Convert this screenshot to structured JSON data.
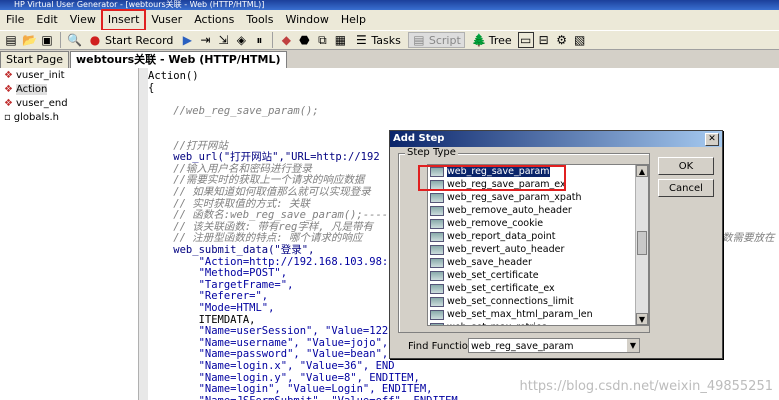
{
  "window": {
    "title": "HP Virtual User Generator - [webtours关联 - Web (HTTP/HTML)]"
  },
  "menu": [
    "File",
    "Edit",
    "View",
    "Insert",
    "Vuser",
    "Actions",
    "Tools",
    "Window",
    "Help"
  ],
  "toolbar": {
    "start_record": "Start Record",
    "tasks": "Tasks",
    "script": "Script",
    "tree": "Tree"
  },
  "tabs": [
    "Start Page",
    "webtours关联 - Web (HTTP/HTML)"
  ],
  "tree": [
    "vuser_init",
    "Action",
    "vuser_end",
    "globals.h"
  ],
  "code": [
    "Action()",
    "{",
    "",
    "    //web_reg_save_param();",
    "",
    "",
    "    //打开网站",
    "    web_url(\"打开网站\",\"URL=http://192",
    "    //输入用户名和密码进行登录",
    "    //需要实时的获取上一个请求的响应数据",
    "    // 如果知道如何取值那么就可以实现登录",
    "    // 实时获取值的方式: 关联",
    "    // 函数名:web_reg_save_param();----",
    "    // 该关联函数: 带有reg字样, 凡是带有",
    "    // 注册型函数的特点: 哪个请求的响应",
    "    web_submit_data(\"登录\",",
    "        \"Action=http://192.168.103.98:",
    "        \"Method=POST\",",
    "        \"TargetFrame=\",",
    "        \"Referer=\",",
    "        \"Mode=HTML\",",
    "        ITEMDATA,",
    "        \"Name=userSession\", \"Value=122",
    "        \"Name=username\", \"Value=jojo\",",
    "        \"Name=password\", \"Value=bean\",",
    "        \"Name=login.x\", \"Value=36\", END",
    "        \"Name=login.y\", \"Value=8\", ENDITEM,",
    "        \"Name=login\", \"Value=Login\", ENDITEM,",
    "        \"Name=JSFormSubmit\", \"Value=off\", ENDITEM,"
  ],
  "code_tail": "数需要放在",
  "dialog": {
    "title": "Add Step",
    "group_label": "Step Type",
    "items": [
      "web_reg_save_param",
      "web_reg_save_param_ex",
      "web_reg_save_param_xpath",
      "web_remove_auto_header",
      "web_remove_cookie",
      "web_report_data_point",
      "web_revert_auto_header",
      "web_save_header",
      "web_set_certificate",
      "web_set_certificate_ex",
      "web_set_connections_limit",
      "web_set_max_html_param_len",
      "web_set_max_retries"
    ],
    "selected_index": 0,
    "ok": "OK",
    "cancel": "Cancel",
    "find_label": "Find Function:",
    "find_value": "web_reg_save_param"
  },
  "watermark": "https://blog.csdn.net/weixin_49855251"
}
